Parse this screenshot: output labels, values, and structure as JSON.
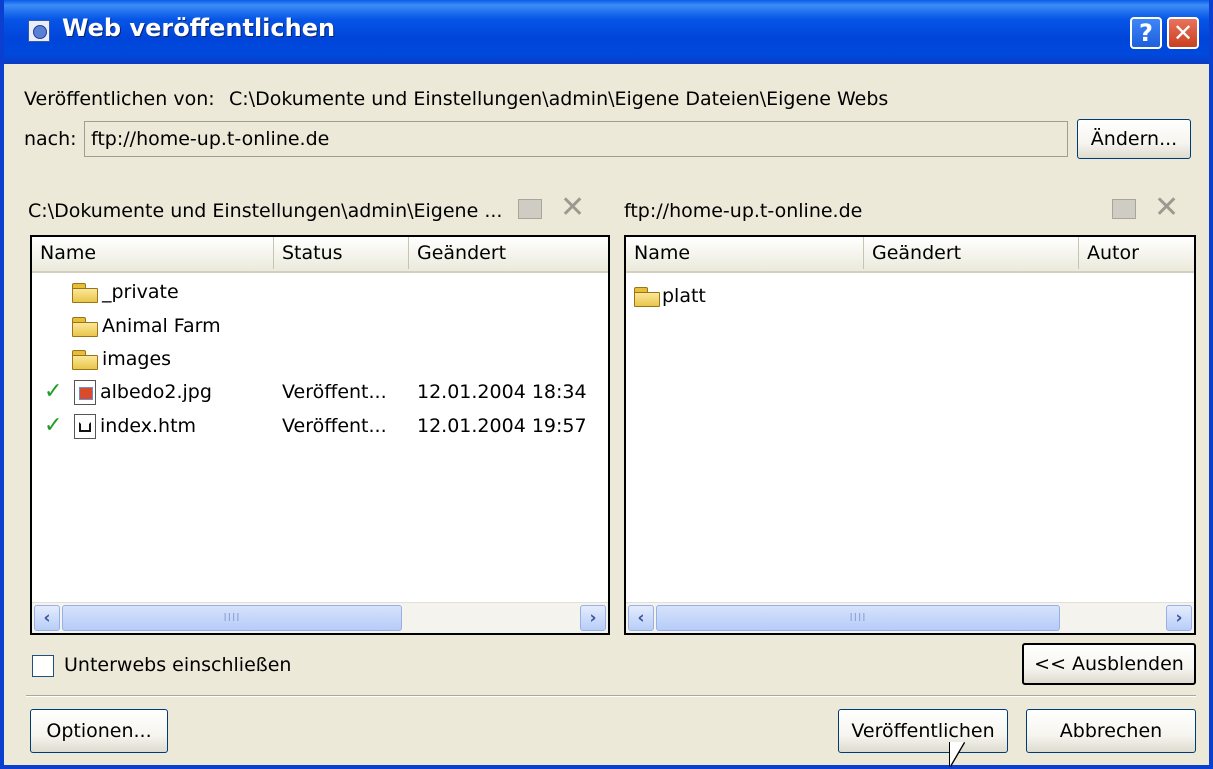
{
  "window": {
    "title": "Web veröffentlichen",
    "help_label": "?",
    "close_label": "✕",
    "colors": {
      "titlebar": "#0045d9",
      "face": "#ece9d8",
      "check": "#1f9d23"
    }
  },
  "source": {
    "label": "Veröffentlichen von:",
    "path": "C:\\Dokumente und Einstellungen\\admin\\Eigene Dateien\\Eigene Webs"
  },
  "destination": {
    "label": "nach:",
    "value": "ftp://home-up.t-online.de",
    "change_button": "Ändern..."
  },
  "left_pane": {
    "header": "C:\\Dokumente und Einstellungen\\admin\\Eigene ...",
    "icons": [
      "new-folder-icon",
      "delete-icon"
    ],
    "columns": [
      "Name",
      "Status",
      "Geändert"
    ],
    "rows": [
      {
        "check": "",
        "icon": "folder-icon",
        "name": "_private",
        "status": "",
        "changed": ""
      },
      {
        "check": "",
        "icon": "folder-icon",
        "name": "Animal Farm",
        "status": "",
        "changed": ""
      },
      {
        "check": "",
        "icon": "folder-icon",
        "name": "images",
        "status": "",
        "changed": ""
      },
      {
        "check": "✓",
        "icon": "image-file-icon",
        "name": "albedo2.jpg",
        "status": "Veröffent...",
        "changed": "12.01.2004 18:34"
      },
      {
        "check": "✓",
        "icon": "html-file-icon",
        "name": "index.htm",
        "status": "Veröffent...",
        "changed": "12.01.2004 19:57"
      }
    ],
    "scroll_left": "‹",
    "scroll_right": "›",
    "thumb_grip": "IIII"
  },
  "right_pane": {
    "header": "ftp://home-up.t-online.de",
    "icons": [
      "new-folder-icon",
      "delete-icon"
    ],
    "columns": [
      "Name",
      "Geändert",
      "Autor"
    ],
    "rows": [
      {
        "icon": "folder-icon",
        "name": "platt"
      }
    ],
    "scroll_left": "‹",
    "scroll_right": "›",
    "thumb_grip": "IIII"
  },
  "include_subwebs": {
    "label": "Unterwebs einschließen",
    "checked": false
  },
  "hide_button": "<< Ausblenden",
  "footer": {
    "options_button": "Optionen...",
    "publish_button": "Veröffentlichen",
    "cancel_button": "Abbrechen"
  }
}
